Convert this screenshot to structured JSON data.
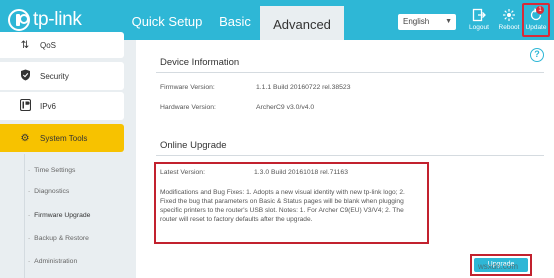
{
  "brand": "tp-link",
  "nav": {
    "quick_setup": "Quick Setup",
    "basic": "Basic",
    "advanced": "Advanced"
  },
  "language": {
    "selected": "English"
  },
  "tools": {
    "logout": "Logout",
    "reboot": "Reboot",
    "update": "Update",
    "update_count": "1"
  },
  "sidebar": {
    "items": [
      {
        "label": "QoS",
        "icon": "qos-icon"
      },
      {
        "label": "Security",
        "icon": "shield-icon"
      },
      {
        "label": "IPv6",
        "icon": "ipv6-icon"
      },
      {
        "label": "System Tools",
        "icon": "gear-icon"
      }
    ],
    "subitems": [
      "Time Settings",
      "Diagnostics",
      "Firmware Upgrade",
      "Backup & Restore",
      "Administration"
    ],
    "active_subitem": "Firmware Upgrade"
  },
  "device_info": {
    "title": "Device Information",
    "firmware_label": "Firmware Version:",
    "firmware_value": "1.1.1 Build 20160722 rel.38523",
    "hardware_label": "Hardware Version:",
    "hardware_value": "ArcherC9 v3.0/v4.0"
  },
  "online_upgrade": {
    "title": "Online Upgrade",
    "latest_label": "Latest Version:",
    "latest_value": "1.3.0 Build 20161018 rel.71163",
    "notes": "Modifications and Bug Fixes: 1. Adopts a new visual identity with new tp-link logo; 2. Fixed the bug that parameters on Basic & Status pages will be blank when plugging specific printers to the router's USB slot. Notes: 1. For Archer C9(EU) V3/V4; 2. The router will reset to factory defaults after the upgrade.",
    "button": "Upgrade"
  },
  "watermark": "wsxdn.com",
  "colors": {
    "accent": "#2eb7d6",
    "active_menu": "#f7c200",
    "highlight": "#c2212e"
  }
}
